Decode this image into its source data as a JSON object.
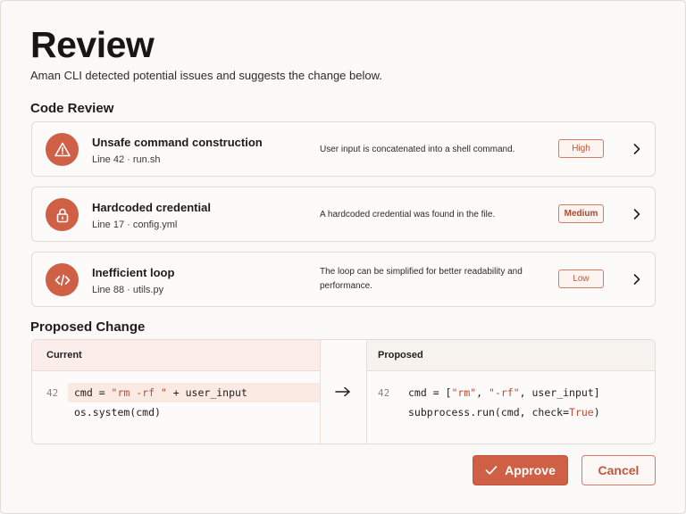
{
  "header": {
    "title": "Review",
    "subtitle": "Aman CLI detected potential issues and suggests the change below."
  },
  "sections": {
    "code_review": "Code Review",
    "proposed_change": "Proposed Change"
  },
  "issues": [
    {
      "icon": "warning-icon",
      "title": "Unsafe command construction",
      "location": "Line 42 · run.sh",
      "description": "User input is concatenated into a shell command.",
      "severity": "High"
    },
    {
      "icon": "lock-icon",
      "title": "Hardcoded credential",
      "location": "Line 17 · config.yml",
      "description": "A hardcoded credential was found in the file.",
      "severity": "Medium"
    },
    {
      "icon": "code-icon",
      "title": "Inefficient loop",
      "location": "Line 88 · utils.py",
      "description": "The loop can be simplified for better readability and performance.",
      "severity": "Low"
    }
  ],
  "diff": {
    "current_label": "Current",
    "proposed_label": "Proposed",
    "line_number": "42",
    "current": {
      "l1_a": "cmd = ",
      "l1_str": "\"rm -rf \"",
      "l1_b": " + user_input",
      "l2": "os.system(cmd)"
    },
    "proposed": {
      "l1_a": "cmd = [",
      "l1_s1": "\"rm\"",
      "l1_sep": ", ",
      "l1_s2": "\"-rf\"",
      "l1_b": ",  user_input]",
      "l2_a": "subprocess.run(cmd, check=",
      "l2_kw": "True",
      "l2_b": ")"
    }
  },
  "actions": {
    "approve": "Approve",
    "cancel": "Cancel"
  },
  "colors": {
    "accent": "#cf5f45",
    "background": "#fbf9f7",
    "badge_border": "#d77a63"
  }
}
